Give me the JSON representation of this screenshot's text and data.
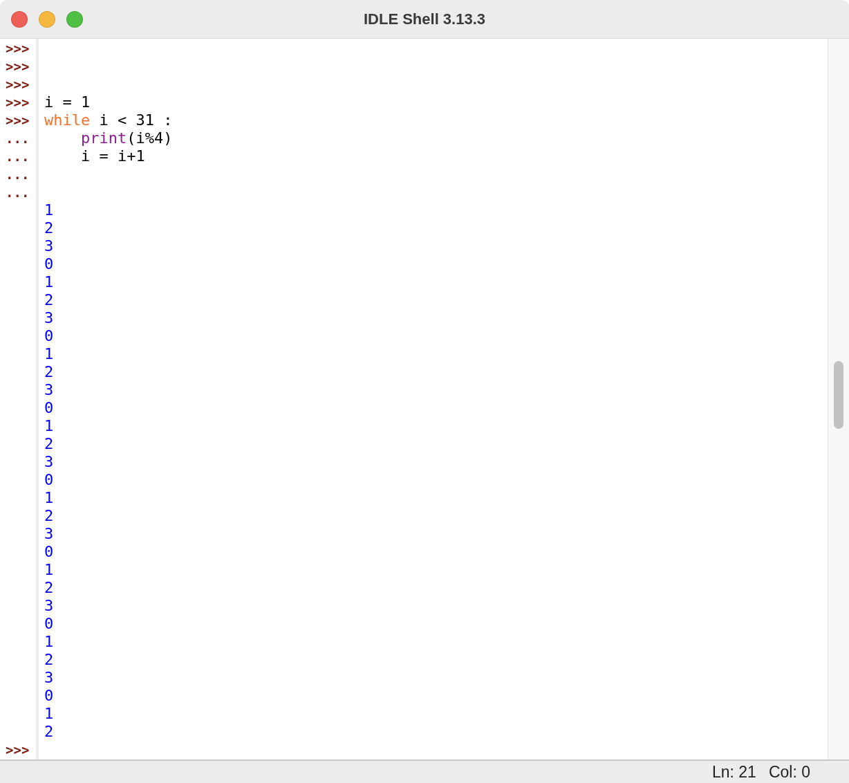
{
  "window": {
    "title": "IDLE Shell 3.13.3"
  },
  "lines": [
    {
      "prompt": ">>>"
    },
    {
      "prompt": ">>>"
    },
    {
      "prompt": ">>>"
    },
    {
      "prompt": ">>>",
      "segments": [
        {
          "kind": "code",
          "text": "i = 1"
        }
      ]
    },
    {
      "prompt": ">>>",
      "segments": [
        {
          "kind": "keyword",
          "text": "while"
        },
        {
          "kind": "code",
          "text": " i < 31 :"
        }
      ]
    },
    {
      "prompt": "...",
      "indented": true,
      "segments": [
        {
          "kind": "builtin",
          "text": "print"
        },
        {
          "kind": "code",
          "text": "(i%4)"
        }
      ]
    },
    {
      "prompt": "...",
      "indented": true,
      "segments": [
        {
          "kind": "code",
          "text": "i = i+1"
        }
      ]
    },
    {
      "prompt": "..."
    },
    {
      "prompt": "..."
    },
    {
      "segments": [
        {
          "kind": "output",
          "text": "1"
        }
      ]
    },
    {
      "segments": [
        {
          "kind": "output",
          "text": "2"
        }
      ]
    },
    {
      "segments": [
        {
          "kind": "output",
          "text": "3"
        }
      ]
    },
    {
      "segments": [
        {
          "kind": "output",
          "text": "0"
        }
      ]
    },
    {
      "segments": [
        {
          "kind": "output",
          "text": "1"
        }
      ]
    },
    {
      "segments": [
        {
          "kind": "output",
          "text": "2"
        }
      ]
    },
    {
      "segments": [
        {
          "kind": "output",
          "text": "3"
        }
      ]
    },
    {
      "segments": [
        {
          "kind": "output",
          "text": "0"
        }
      ]
    },
    {
      "segments": [
        {
          "kind": "output",
          "text": "1"
        }
      ]
    },
    {
      "segments": [
        {
          "kind": "output",
          "text": "2"
        }
      ]
    },
    {
      "segments": [
        {
          "kind": "output",
          "text": "3"
        }
      ]
    },
    {
      "segments": [
        {
          "kind": "output",
          "text": "0"
        }
      ]
    },
    {
      "segments": [
        {
          "kind": "output",
          "text": "1"
        }
      ]
    },
    {
      "segments": [
        {
          "kind": "output",
          "text": "2"
        }
      ]
    },
    {
      "segments": [
        {
          "kind": "output",
          "text": "3"
        }
      ]
    },
    {
      "segments": [
        {
          "kind": "output",
          "text": "0"
        }
      ]
    },
    {
      "segments": [
        {
          "kind": "output",
          "text": "1"
        }
      ]
    },
    {
      "segments": [
        {
          "kind": "output",
          "text": "2"
        }
      ]
    },
    {
      "segments": [
        {
          "kind": "output",
          "text": "3"
        }
      ]
    },
    {
      "segments": [
        {
          "kind": "output",
          "text": "0"
        }
      ]
    },
    {
      "segments": [
        {
          "kind": "output",
          "text": "1"
        }
      ]
    },
    {
      "segments": [
        {
          "kind": "output",
          "text": "2"
        }
      ]
    },
    {
      "segments": [
        {
          "kind": "output",
          "text": "3"
        }
      ]
    },
    {
      "segments": [
        {
          "kind": "output",
          "text": "0"
        }
      ]
    },
    {
      "segments": [
        {
          "kind": "output",
          "text": "1"
        }
      ]
    },
    {
      "segments": [
        {
          "kind": "output",
          "text": "2"
        }
      ]
    },
    {
      "segments": [
        {
          "kind": "output",
          "text": "3"
        }
      ]
    },
    {
      "segments": [
        {
          "kind": "output",
          "text": "0"
        }
      ]
    },
    {
      "segments": [
        {
          "kind": "output",
          "text": "1"
        }
      ]
    },
    {
      "segments": [
        {
          "kind": "output",
          "text": "2"
        }
      ]
    },
    {
      "prompt": ">>>"
    }
  ],
  "status_bar": {
    "line": "Ln: 21",
    "column": "Col: 0"
  }
}
